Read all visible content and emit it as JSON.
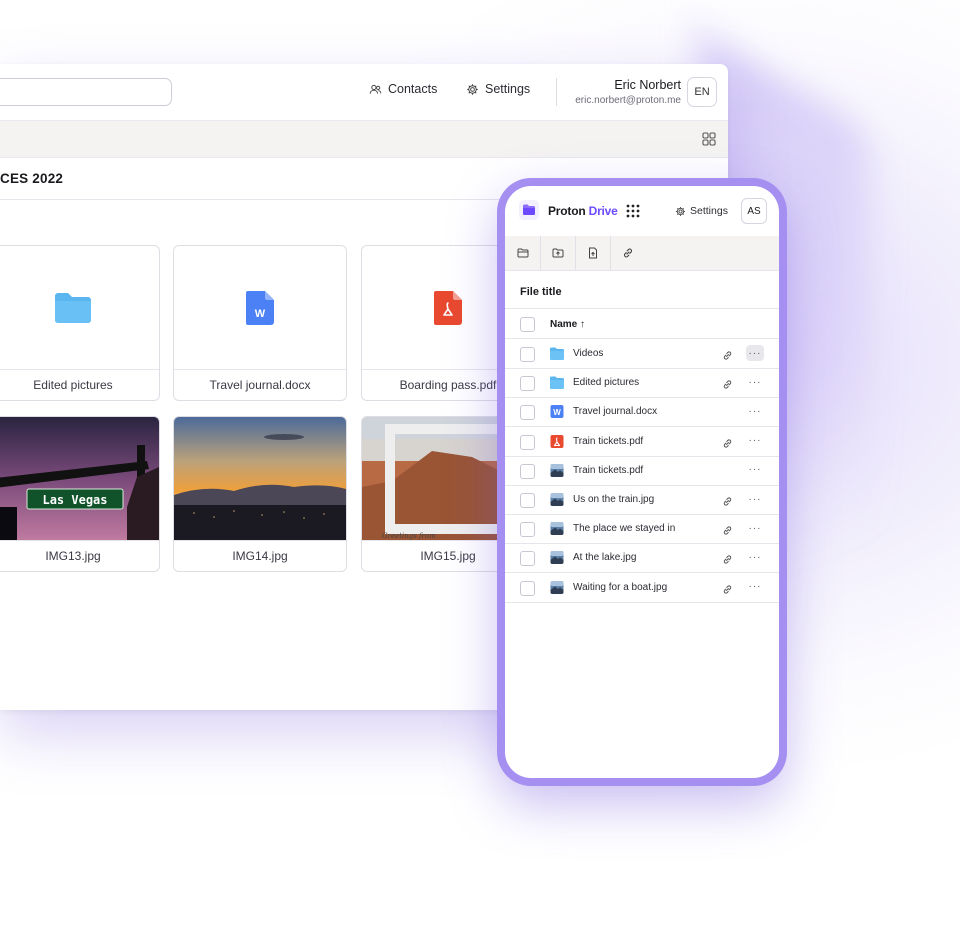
{
  "desktop": {
    "nav": {
      "contacts": "Contacts",
      "settings": "Settings"
    },
    "user": {
      "name": "Eric Norbert",
      "email": "eric.norbert@proton.me",
      "lang": "EN"
    },
    "breadcrumb": "CES 2022",
    "cards": [
      {
        "label": "Edited pictures",
        "icon": "folder-icon"
      },
      {
        "label": "Travel journal.docx",
        "icon": "word-doc-icon"
      },
      {
        "label": "Boarding pass.pdf",
        "icon": "pdf-icon"
      },
      {
        "label": "IMG13.jpg",
        "icon": "photo-las-vegas"
      },
      {
        "label": "IMG14.jpg",
        "icon": "photo-sunset"
      },
      {
        "label": "IMG15.jpg",
        "icon": "photo-canyon"
      }
    ]
  },
  "mobile": {
    "brand": {
      "name": "Proton",
      "product": "Drive"
    },
    "settings": "Settings",
    "avatar": "AS",
    "file_title": "File title",
    "column_header": "Name ↑",
    "rows": [
      {
        "name": "Videos",
        "icon": "folder-icon",
        "linked": true,
        "active": true
      },
      {
        "name": "Edited pictures",
        "icon": "folder-icon",
        "linked": true,
        "active": false
      },
      {
        "name": "Travel journal.docx",
        "icon": "word-doc-icon",
        "linked": false,
        "active": false
      },
      {
        "name": "Train tickets.pdf",
        "icon": "pdf-icon",
        "linked": true,
        "active": false
      },
      {
        "name": "Train tickets.pdf",
        "icon": "image-icon",
        "linked": false,
        "active": false
      },
      {
        "name": "Us on the train.jpg",
        "icon": "image-icon",
        "linked": true,
        "active": false
      },
      {
        "name": "The place we stayed in",
        "icon": "image-icon",
        "linked": true,
        "active": false
      },
      {
        "name": "At the lake.jpg",
        "icon": "image-icon",
        "linked": true,
        "active": false
      },
      {
        "name": "Waiting for a boat.jpg",
        "icon": "image-icon",
        "linked": true,
        "active": false
      }
    ],
    "more_label": "···"
  },
  "colors": {
    "brand": "#6d4aff",
    "phone_frame": "#a590f2",
    "folder": "#5bb6f0",
    "word": "#4c80f5",
    "pdf": "#e9492e"
  }
}
